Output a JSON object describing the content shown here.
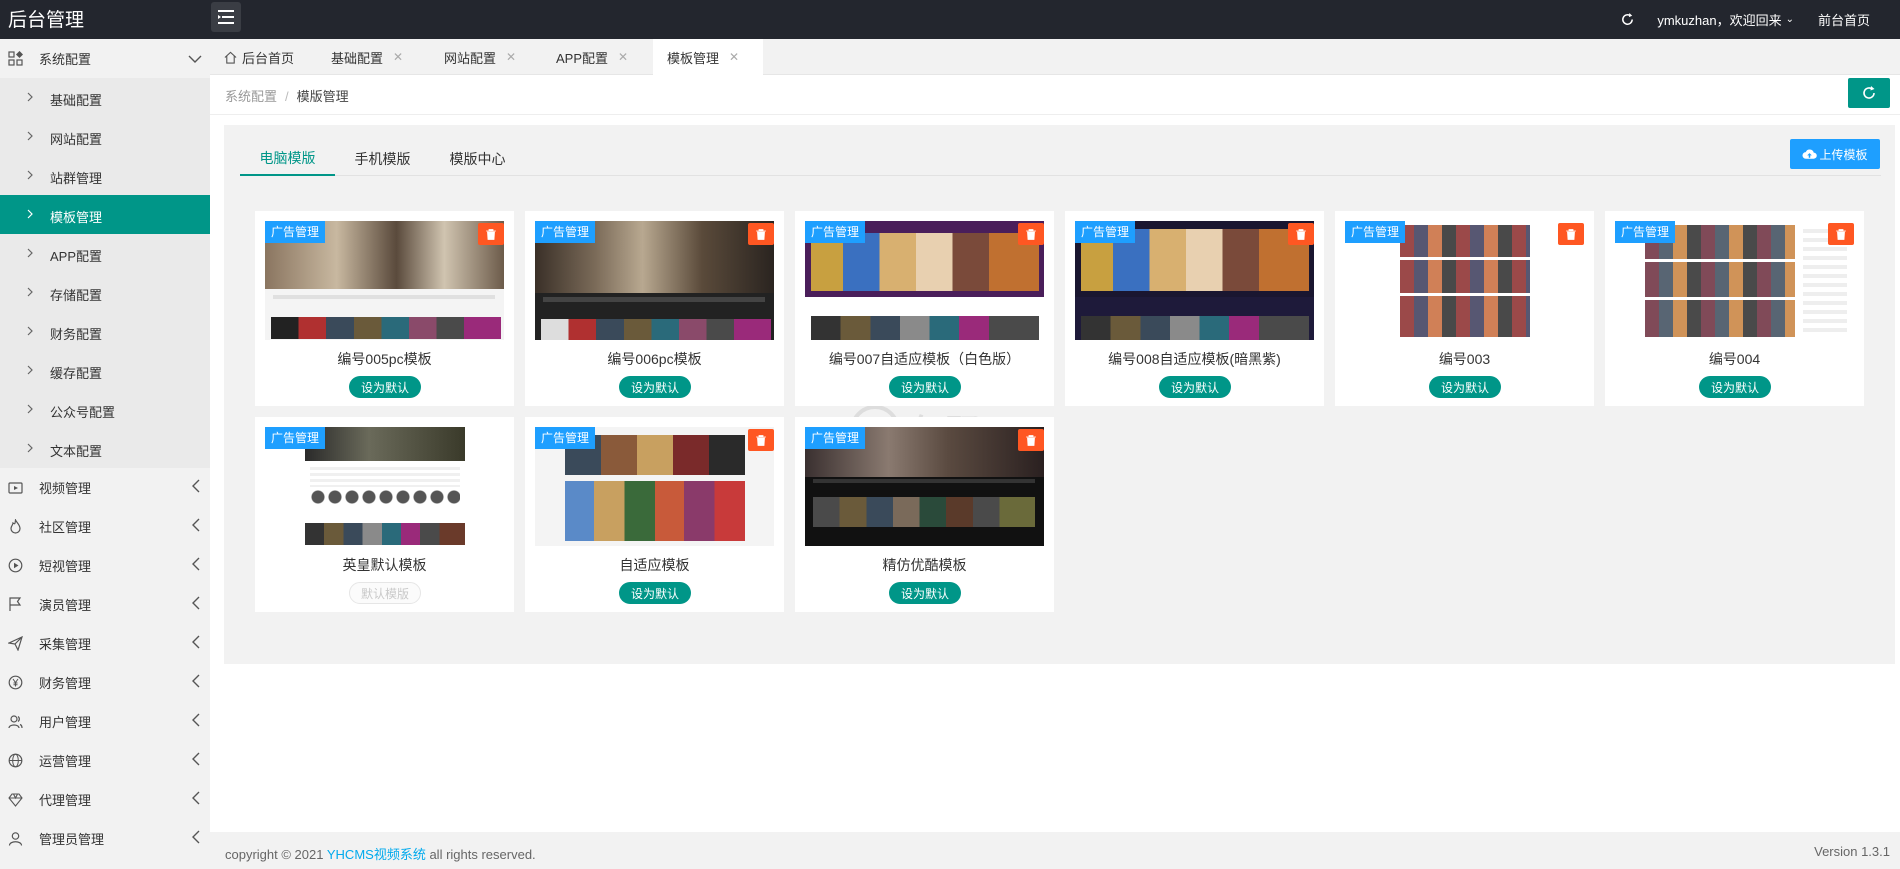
{
  "header": {
    "brand": "后台管理",
    "welcome": "ymkuzhan，欢迎回来",
    "front_home": "前台首页"
  },
  "sidebar": {
    "groups": [
      {
        "label": "系统配置",
        "icon": "apps-icon",
        "expanded": true
      },
      {
        "label": "视频管理",
        "icon": "video-icon"
      },
      {
        "label": "社区管理",
        "icon": "fire-icon"
      },
      {
        "label": "短视管理",
        "icon": "play-circle-icon"
      },
      {
        "label": "演员管理",
        "icon": "flag-icon"
      },
      {
        "label": "采集管理",
        "icon": "send-icon"
      },
      {
        "label": "财务管理",
        "icon": "yen-icon"
      },
      {
        "label": "用户管理",
        "icon": "users-icon"
      },
      {
        "label": "运营管理",
        "icon": "globe-icon"
      },
      {
        "label": "代理管理",
        "icon": "diamond-icon"
      },
      {
        "label": "管理员管理",
        "icon": "user-icon"
      }
    ],
    "sub_items": [
      {
        "label": "基础配置"
      },
      {
        "label": "网站配置"
      },
      {
        "label": "站群管理"
      },
      {
        "label": "模板管理",
        "active": true
      },
      {
        "label": "APP配置"
      },
      {
        "label": "存储配置"
      },
      {
        "label": "财务配置"
      },
      {
        "label": "缓存配置"
      },
      {
        "label": "公众号配置"
      },
      {
        "label": "文本配置"
      }
    ]
  },
  "tabs": [
    {
      "label": "后台首页"
    },
    {
      "label": "基础配置"
    },
    {
      "label": "网站配置"
    },
    {
      "label": "APP配置"
    },
    {
      "label": "模板管理",
      "active": true
    }
  ],
  "breadcrumb": {
    "parent": "系统配置",
    "separator": "/",
    "current": "模版管理"
  },
  "inner_tabs": [
    {
      "label": "电脑模版",
      "active": true
    },
    {
      "label": "手机模版"
    },
    {
      "label": "模版中心"
    }
  ],
  "upload_label": "上传模板",
  "tag_label": "广告管理",
  "set_default_label": "设为默认",
  "default_label": "默认模版",
  "templates": [
    {
      "name": "编号005pc模板",
      "is_default": false,
      "deletable": true
    },
    {
      "name": "编号006pc模板",
      "is_default": false,
      "deletable": true
    },
    {
      "name": "编号007自适应模板（白色版）",
      "is_default": false,
      "deletable": true
    },
    {
      "name": "编号008自适应模板(暗黑紫)",
      "is_default": false,
      "deletable": true
    },
    {
      "name": "编号003",
      "is_default": false,
      "deletable": true
    },
    {
      "name": "编号004",
      "is_default": false,
      "deletable": true
    },
    {
      "name": "英皇默认模板",
      "is_default": true,
      "deletable": false
    },
    {
      "name": "自适应模板",
      "is_default": false,
      "deletable": true
    },
    {
      "name": "精仿优酷模板",
      "is_default": false,
      "deletable": true
    }
  ],
  "footer": {
    "copyright_prefix": "copyright © 2021",
    "copyright_link": "YHCMS视频系统",
    "copyright_suffix": "all rights reserved.",
    "version": "Version 1.3.1"
  },
  "colors": {
    "accent": "#009688",
    "blue": "#1e9fff",
    "danger": "#ff5722",
    "header": "#23262e"
  }
}
